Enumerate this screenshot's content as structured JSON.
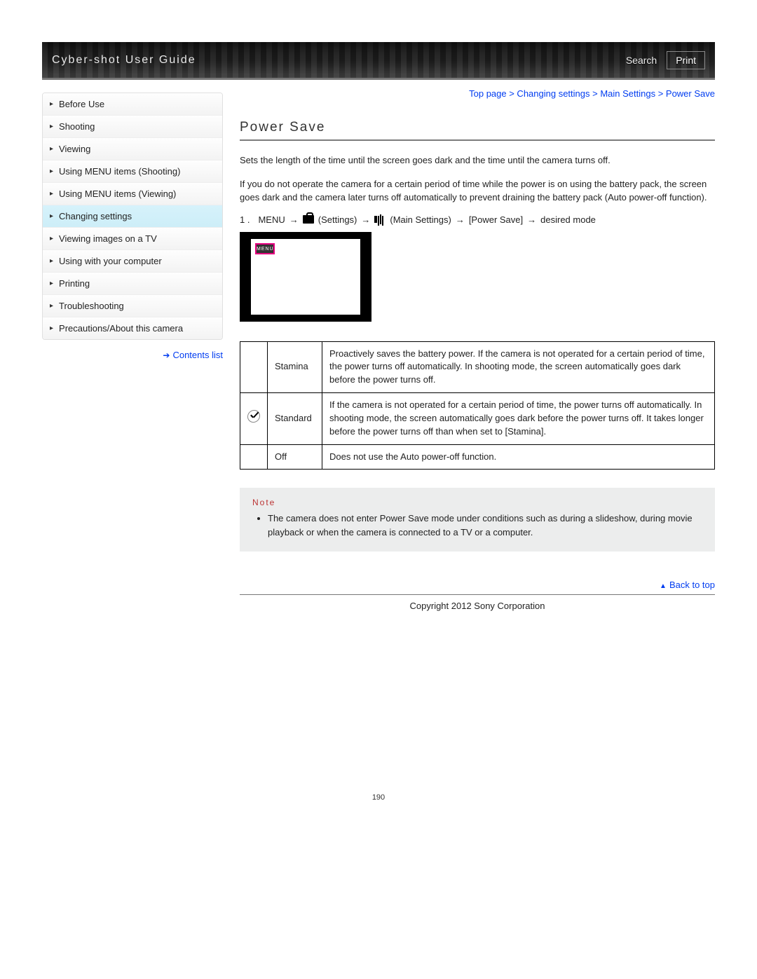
{
  "header": {
    "title": "Cyber-shot User Guide",
    "search_label": "Search",
    "print_label": "Print"
  },
  "sidebar": {
    "items": [
      {
        "label": "Before Use"
      },
      {
        "label": "Shooting"
      },
      {
        "label": "Viewing"
      },
      {
        "label": "Using MENU items (Shooting)"
      },
      {
        "label": "Using MENU items (Viewing)"
      },
      {
        "label": "Changing settings"
      },
      {
        "label": "Viewing images on a TV"
      },
      {
        "label": "Using with your computer"
      },
      {
        "label": "Printing"
      },
      {
        "label": "Troubleshooting"
      },
      {
        "label": "Precautions/About this camera"
      }
    ],
    "active_index": 5,
    "contents_list_label": "Contents list"
  },
  "breadcrumb": "Top page > Changing settings > Main Settings > Power Save",
  "page_title": "Power Save",
  "intro_1": "Sets the length of the time until the screen goes dark and the time until the camera turns off.",
  "intro_2": "If you do not operate the camera for a certain period of time while the power is on using the battery pack, the screen goes dark and the camera later turns off automatically to prevent draining the battery pack (Auto power-off function).",
  "step": {
    "num": "1 .",
    "menu": "MENU",
    "settings": "(Settings)",
    "main_settings": "(Main Settings)",
    "power_save": "[Power Save]",
    "desired": "desired mode"
  },
  "screen_chip": "MENU",
  "table": {
    "rows": [
      {
        "checked": false,
        "name": "Stamina",
        "desc": "Proactively saves the battery power.\nIf the camera is not operated for a certain period of time, the power turns off automatically. In shooting mode, the screen automatically goes dark before the power turns off."
      },
      {
        "checked": true,
        "name": "Standard",
        "desc": "If the camera is not operated for a certain period of time, the power turns off automatically. In shooting mode, the screen automatically goes dark before the power turns off.\nIt takes longer before the power turns off than when set to [Stamina]."
      },
      {
        "checked": false,
        "name": "Off",
        "desc": "Does not use the Auto power-off function."
      }
    ]
  },
  "note": {
    "title": "Note",
    "items": [
      "The camera does not enter Power Save mode under conditions such as during a slideshow, during movie playback or when the camera is connected to a TV or a computer."
    ]
  },
  "back_to_top": "Back to top",
  "copyright": "Copyright 2012 Sony Corporation",
  "page_number": "190"
}
